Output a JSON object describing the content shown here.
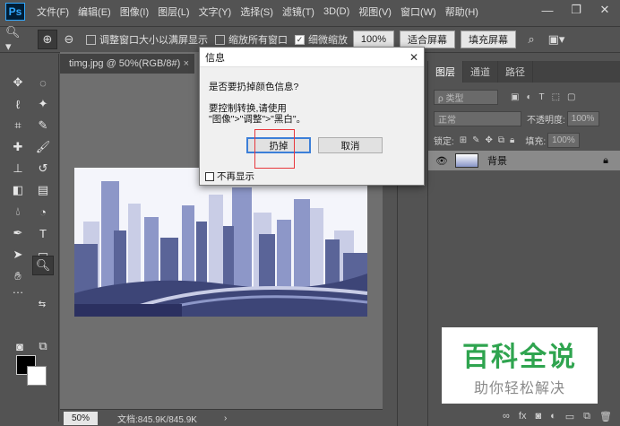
{
  "app": {
    "logo": "Ps"
  },
  "menu": [
    "文件(F)",
    "编辑(E)",
    "图像(I)",
    "图层(L)",
    "文字(Y)",
    "选择(S)",
    "滤镜(T)",
    "3D(D)",
    "视图(V)",
    "窗口(W)",
    "帮助(H)"
  ],
  "options": {
    "resize_windows": "调整窗口大小以满屏显示",
    "zoom_all": "缩放所有窗口",
    "scrubby_zoom": "细微缩放",
    "zoom_value": "100%",
    "fit_screen": "适合屏幕",
    "fill_screen": "填充屏幕"
  },
  "document": {
    "tab_title": "timg.jpg @ 50%(RGB/8#)",
    "zoom": "50%",
    "doc_info": "文档:845.9K/845.9K"
  },
  "layers_panel": {
    "tabs": [
      "图层",
      "通道",
      "路径"
    ],
    "filter_placeholder": "ρ 类型",
    "blend_mode": "正常",
    "opacity_label": "不透明度:",
    "opacity_value": "100%",
    "lock_label": "锁定:",
    "fill_label": "填充:",
    "fill_value": "100%",
    "layer_name": "背景"
  },
  "dialog": {
    "title": "信息",
    "question": "是否要扔掉颜色信息?",
    "hint_line1": "要控制转换,请使用",
    "hint_line2": "\"图像\">\"调整\">\"黑白\"。",
    "discard_button": "扔掉",
    "cancel_button": "取消",
    "dont_show": "不再显示"
  },
  "watermark": {
    "title": "百科全说",
    "subtitle": "助你轻松解决"
  },
  "colors": {
    "background": "#535353",
    "dialog": "#f0f0f0",
    "highlight": "#e8383d",
    "watermark_green": "#2fa44f"
  }
}
